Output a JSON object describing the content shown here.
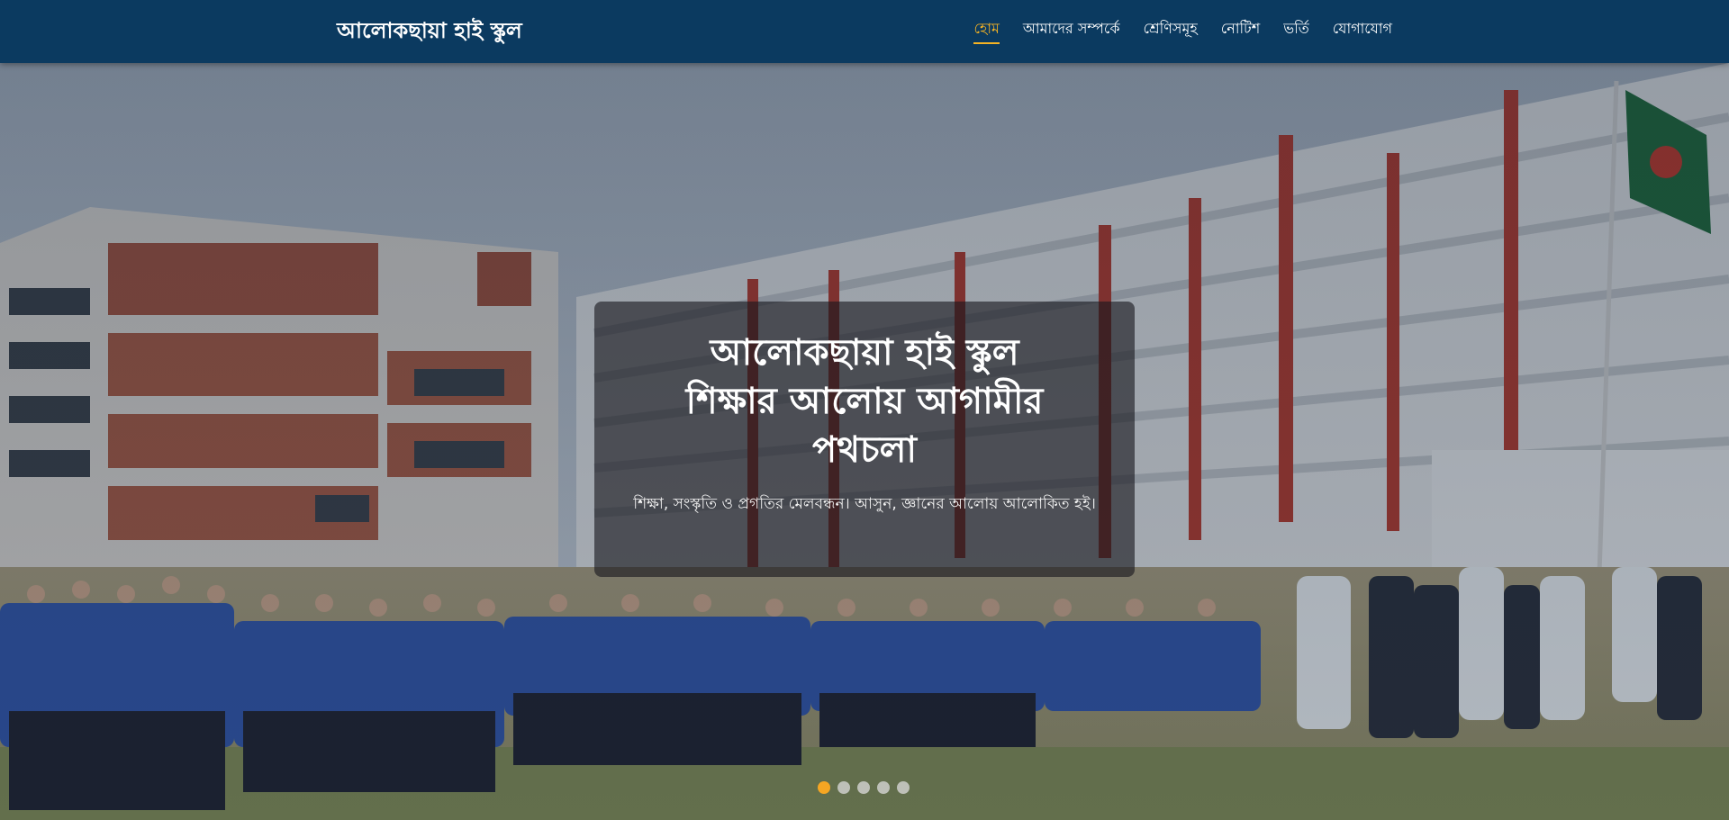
{
  "brand": {
    "name": "আলোকছায়া হাই স্কুল"
  },
  "nav": {
    "items": [
      {
        "label": "হোম",
        "active": true
      },
      {
        "label": "আমাদের সম্পর্কে"
      },
      {
        "label": "শ্রেণিসমূহ"
      },
      {
        "label": "নোটিশ"
      },
      {
        "label": "ভর্তি"
      },
      {
        "label": "যোগাযোগ"
      }
    ]
  },
  "hero": {
    "title_line1": "আলোকছায়া হাই স্কুল",
    "title_line2": "শিক্ষার আলোয় আগামীর",
    "title_line3": "পথচলা",
    "subtitle": "শিক্ষা, সংস্কৃতি ও প্রগতির মেলবন্ধন। আসুন, জ্ঞানের আলোয় আলোকিত হই।"
  },
  "carousel": {
    "slide_count": 5,
    "active_index": 0
  },
  "colors": {
    "navbar": "#0b3a60",
    "accent": "#f5b324",
    "dot_active": "#f5a623"
  }
}
